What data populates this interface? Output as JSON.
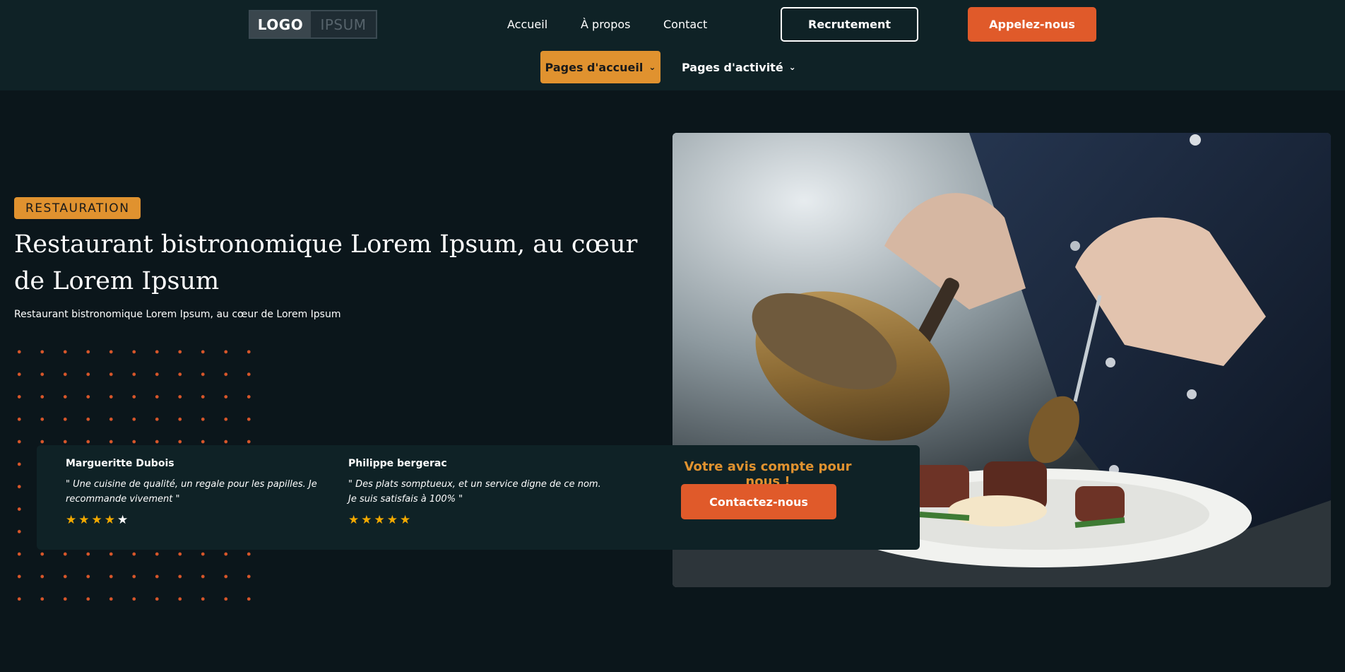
{
  "header": {
    "logo_left": "LOGO",
    "logo_right": "IPSUM",
    "nav": [
      "Accueil",
      "À propos",
      "Contact"
    ],
    "btn_recrutement": "Recrutement",
    "btn_call": "Appelez-nous",
    "dropdown_accueil": "Pages d'accueil",
    "dropdown_activite": "Pages d'activité"
  },
  "hero": {
    "tag": "RESTAURATION",
    "title": "Restaurant bistronomique Lorem Ipsum, au cœur de Lorem Ipsum",
    "subtitle": "Restaurant bistronomique Lorem Ipsum, au cœur de Lorem Ipsum",
    "photo_icon": "chef-plating-photo"
  },
  "reviews": [
    {
      "name": "Margueritte Dubois",
      "text": "\" Une cuisine de qualité, un regale pour les papilles. Je recommande vivement  \"",
      "rating": 4
    },
    {
      "name": "Philippe bergerac",
      "text": "\" Des plats somptueux, et un service digne de ce nom. Je suis satisfais à 100% \"",
      "rating": 5
    }
  ],
  "cta": {
    "title": "Votre avis compte pour nous !",
    "button": "Contactez-nous"
  },
  "colors": {
    "accent_orange": "#e05a2a",
    "accent_gold": "#e0922f",
    "background": "#0b161b",
    "header_bg": "#0f2226",
    "star": "#f2a900"
  }
}
